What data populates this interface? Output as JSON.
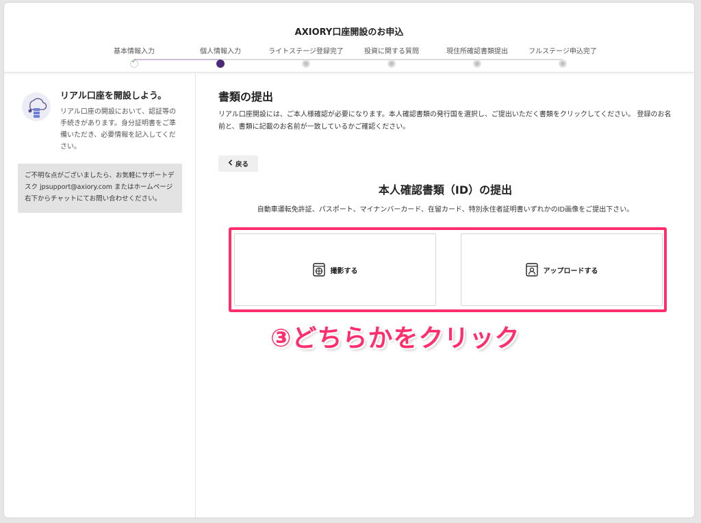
{
  "header": {
    "title": "AXIORY口座開設のお申込",
    "steps": [
      {
        "label": "基本情報入力",
        "state": "done"
      },
      {
        "label": "個人情報入力",
        "state": "current"
      },
      {
        "label": "ライトステージ登録完了",
        "state": "pending"
      },
      {
        "label": "投資に関する質問",
        "state": "pending"
      },
      {
        "label": "現住所確認書類提出",
        "state": "pending"
      },
      {
        "label": "フルステージ申込完了",
        "state": "pending"
      }
    ]
  },
  "sidebar": {
    "icon": "cloud-server-icon",
    "title": "リアル口座を開設しよう。",
    "description": "リアル口座の開設において、認証等の手続きがあります。身分証明書をご準備いただき、必要情報を記入してください。",
    "support": "ご不明な点がございましたら、お気軽にサポートデスク jpsupport@axiory.com またはホームページ右下からチャットにてお問い合わせください。"
  },
  "main": {
    "title": "書類の提出",
    "intro": "リアル口座開設には、ご本人様確認が必要になります。本人確認書類の発行国を選択し、ご提出いただく書類をクリックしてください。 登録のお名前と、書類に記載のお名前が一致しているかご確認ください。",
    "back_label": "戻る",
    "section_title": "本人確認書類（ID）の提出",
    "section_sub": "自動車運転免許証、パスポート、マイナンバーカード、在留カード、特別永住者証明書いずれかのID画像をご提出下さい。",
    "options": {
      "camera_label": "撮影する",
      "upload_label": "アップロードする"
    },
    "annotation": "③どちらかをクリック"
  },
  "colors": {
    "accent": "#4b2a7b",
    "highlight": "#ff2f6e"
  }
}
